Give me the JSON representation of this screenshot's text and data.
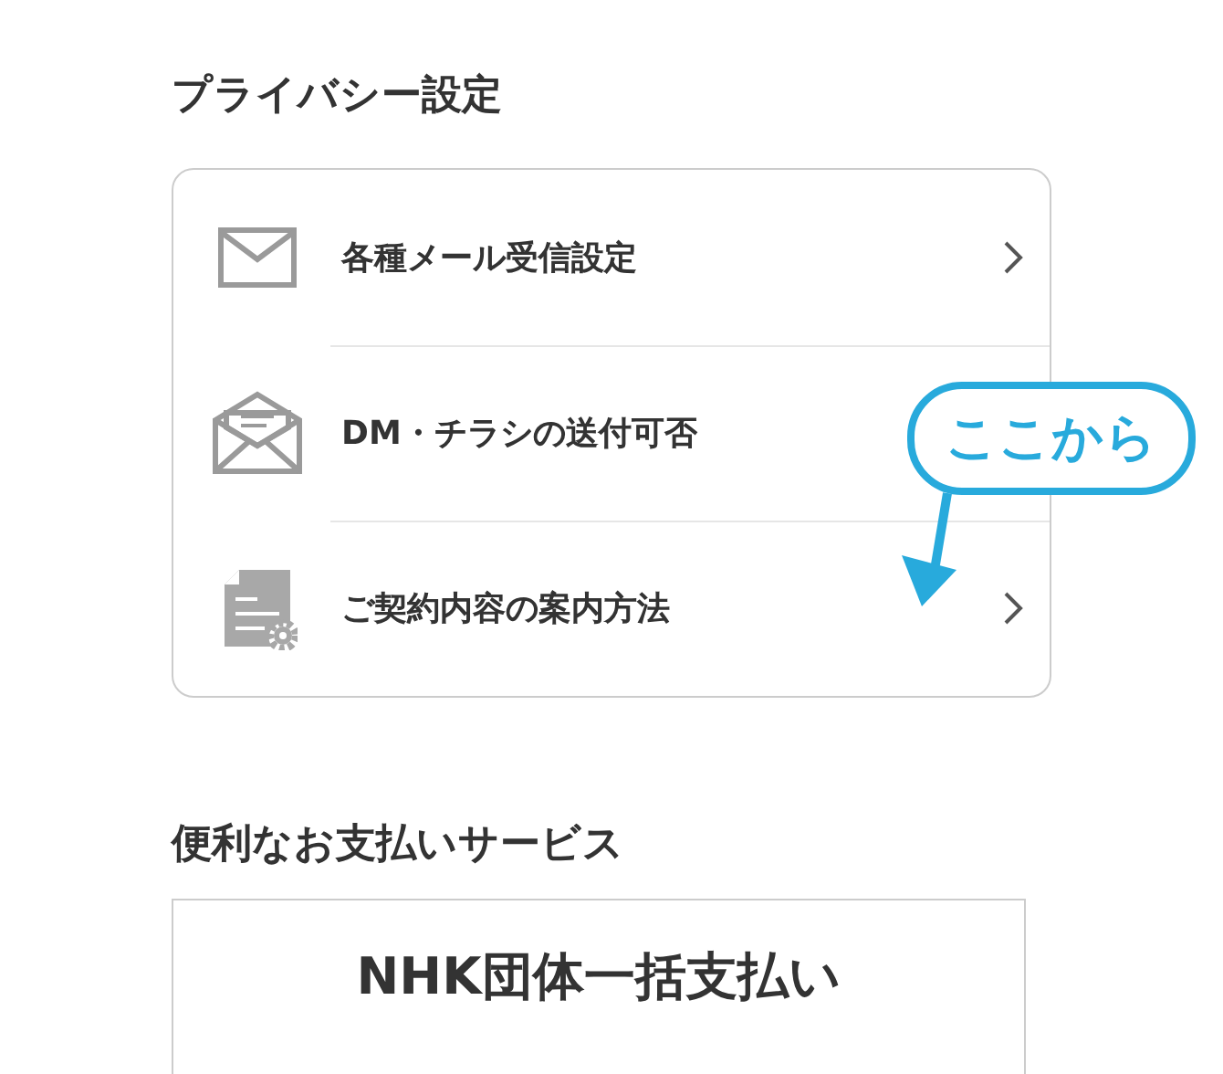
{
  "sections": [
    {
      "title": "プライバシー設定",
      "kind": "list",
      "items": [
        {
          "label": "各種メール受信設定",
          "chevron": true
        },
        {
          "label": "DM・チラシの送付可否",
          "chevron": false
        },
        {
          "label": "ご契約内容の案内方法",
          "chevron": true
        }
      ]
    },
    {
      "title": "便利なお支払いサービス",
      "kind": "button",
      "label": "NHK団体一括支払い"
    }
  ],
  "callout": {
    "text": "ここから"
  }
}
